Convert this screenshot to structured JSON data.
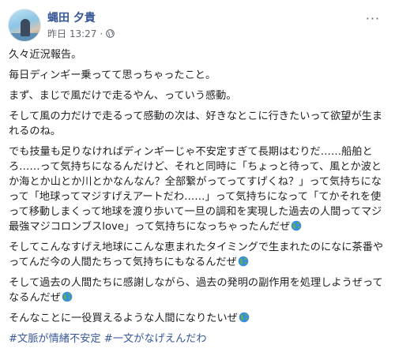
{
  "post": {
    "author": "蝿田 夕貴",
    "timestamp": "昨日 13:27",
    "meta_dot": "·",
    "more_label": "···",
    "paragraphs": [
      "久々近況報告。",
      "毎日ディンギー乗ってて思っちゃったこと。",
      "まず、まじで風だけで走るやん、っていう感動。",
      "そして風の力だけで走るって感動の次は、好きなとこに行きたいって欲望が生まれるのね。",
      "でも技量も足りなければディンギーじゃ不安定すぎて長期はむりだ……船舶とろ……って気持ちになるんだけど、それと同時に「ちょっと待って、風とか波とか海とか山とか川とかなんなん？全部繋がってってすげくね？」って気持ちになって「地球ってマジすげえアートだわ……」って気持ちになって「てかそれを使って移動しまくって地球を渡り歩いて一旦の調和を実現した過去の人間ってマジ最強マジコロンブスlove」って気持ちになっちゃったんだぜ",
      "そしてこんなすげえ地球にこんな恵まれたタイミングで生まれたのになに茶番やってんだ今の人間たちって気持ちにもなるんだぜ",
      "そして過去の人間たちに感謝しながら、過去の発明の副作用を処理しようぜってなるんだぜ",
      "そんなことに一役買えるような人間になりたいぜ"
    ],
    "hashtags": [
      "#文脈が情緒不安定",
      "#一文がなげえんだわ"
    ]
  },
  "colors": {
    "author_link": "#385898",
    "text": "#1c1e21",
    "meta": "#616770"
  },
  "icons": {
    "audience": "globe-icon",
    "emoji": "earth-globe-emoji-icon",
    "menu": "more-options-icon"
  }
}
